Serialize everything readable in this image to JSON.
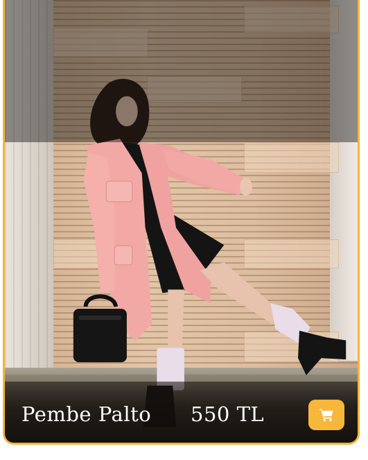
{
  "product": {
    "name": "Pembe Palto",
    "price": "550 TL"
  },
  "actions": {
    "cart_icon": "shopping-cart-icon"
  },
  "colors": {
    "card_border": "#F4B43A",
    "cart_button": "#F7B73A",
    "text": "#ffffff",
    "coat": "#F2A9A6"
  }
}
